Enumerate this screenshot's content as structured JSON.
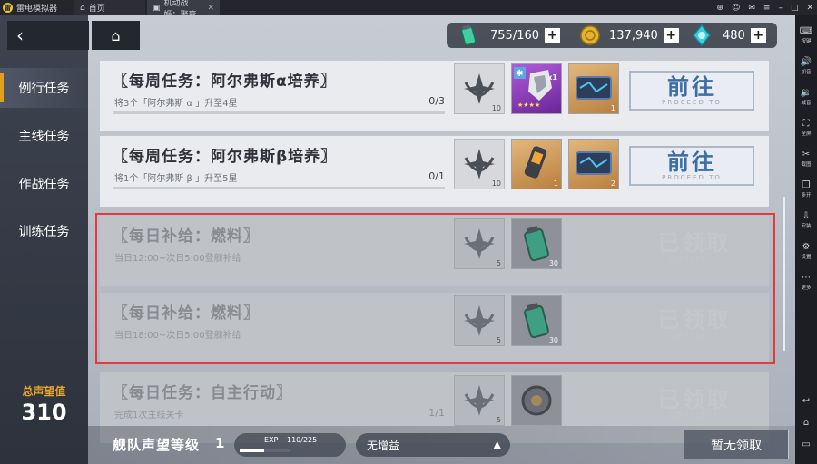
{
  "titlebar": {
    "app_name": "雷电模拟器",
    "tabs": [
      {
        "label": "首页"
      },
      {
        "label": "机动战姬：聚变"
      }
    ]
  },
  "side_strip": {
    "items": [
      {
        "label": "按键",
        "icon": "keyboard-icon"
      },
      {
        "label": "加音",
        "icon": "volume-up-icon"
      },
      {
        "label": "减音",
        "icon": "volume-down-icon"
      },
      {
        "label": "全屏",
        "icon": "fullscreen-icon"
      },
      {
        "label": "截图",
        "icon": "scissors-icon"
      },
      {
        "label": "多开",
        "icon": "multi-instance-icon"
      },
      {
        "label": "安装",
        "icon": "install-apk-icon"
      },
      {
        "label": "设置",
        "icon": "gear-icon"
      },
      {
        "label": "更多",
        "icon": "more-icon"
      }
    ]
  },
  "sidebar": {
    "items": [
      {
        "label": "例行任务",
        "active": true
      },
      {
        "label": "主线任务"
      },
      {
        "label": "作战任务"
      },
      {
        "label": "训练任务"
      }
    ],
    "prestige_label": "总声望值",
    "prestige_value": "310"
  },
  "resources": [
    {
      "value": "755/160",
      "icon": "fuel-canister-icon"
    },
    {
      "value": "137,940",
      "icon": "gold-coin-icon"
    },
    {
      "value": "480",
      "icon": "crystal-icon"
    }
  ],
  "tasks": [
    {
      "title": "〖每周任务：阿尔弗斯α培养〗",
      "desc": "将3个「阿尔弗斯 α 」升至4星",
      "progress": "0/3",
      "badge_num": "10",
      "rewards": [
        {
          "qty": "x1"
        },
        {
          "qty": "1"
        }
      ],
      "button": "前往",
      "button_sub": "PROCEED TO"
    },
    {
      "title": "〖每周任务：阿尔弗斯β培养〗",
      "desc": "将1个「阿尔弗斯 β 」升至5星",
      "progress": "0/1",
      "badge_num": "10",
      "rewards": [
        {
          "qty": "1"
        },
        {
          "qty": "2"
        }
      ],
      "button": "前往",
      "button_sub": "PROCEED TO"
    },
    {
      "title": "〖每日补给：燃料〗",
      "desc": "当日12:00~次日5:00登舰补给",
      "progress": "",
      "badge_num": "5",
      "rewards": [
        {
          "qty": "30"
        }
      ],
      "button": "已领取",
      "button_sub": "COMPLETE"
    },
    {
      "title": "〖每日补给：燃料〗",
      "desc": "当日18:00~次日5:00登舰补给",
      "progress": "",
      "badge_num": "5",
      "rewards": [
        {
          "qty": "30"
        }
      ],
      "button": "已领取",
      "button_sub": "COMPLETE"
    },
    {
      "title": "〖每日任务：自主行动〗",
      "desc": "完成1次主线关卡",
      "progress": "1/1",
      "badge_num": "5",
      "rewards": [
        {
          "qty": ""
        }
      ],
      "button": "已领取",
      "button_sub": "COMPLETE"
    }
  ],
  "bottom": {
    "fleet_label": "舰队声望等级",
    "fleet_level": "1",
    "exp_label": "EXP",
    "exp_value": "110/225",
    "exp_progress": 0.49,
    "buff_value": "无增益",
    "claim_button": "暂无领取"
  }
}
